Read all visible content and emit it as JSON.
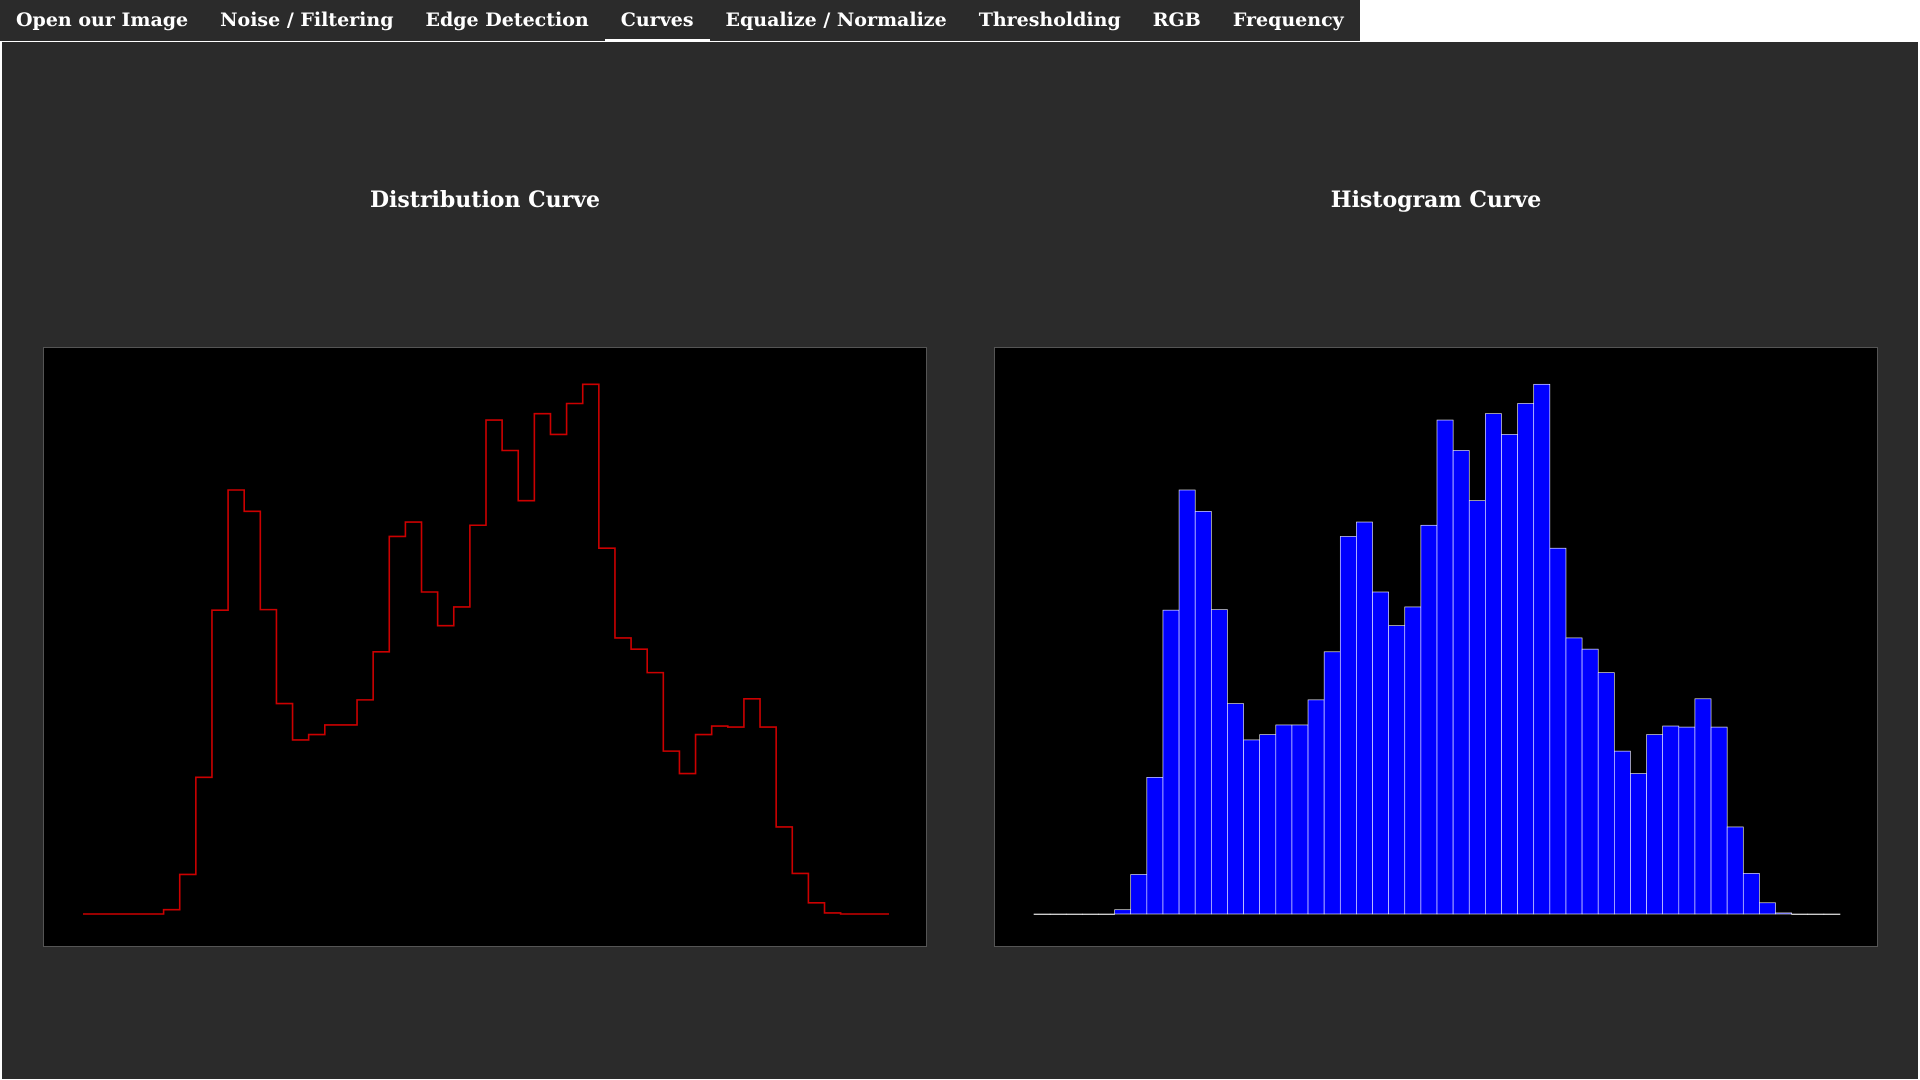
{
  "tabs": [
    {
      "label": "Open our Image",
      "active": false
    },
    {
      "label": "Noise / Filtering",
      "active": false
    },
    {
      "label": "Edge Detection",
      "active": false
    },
    {
      "label": "Curves",
      "active": true
    },
    {
      "label": "Equalize / Normalize",
      "active": false
    },
    {
      "label": "Thresholding",
      "active": false
    },
    {
      "label": "RGB",
      "active": false
    },
    {
      "label": "Frequency",
      "active": false
    }
  ],
  "colors": {
    "background": "#2b2b2b",
    "plot_background": "#000000",
    "distribution_line": "#cc0000",
    "histogram_fill": "#0000ff",
    "histogram_edge": "#ffffff"
  },
  "chart_data": [
    {
      "type": "line",
      "title": "Distribution Curve",
      "step": true,
      "bins": 50,
      "values": [
        0.0,
        0.0,
        0.0,
        0.0,
        0.0,
        0.8,
        7.4,
        25.6,
        56.9,
        79.4,
        75.4,
        57.0,
        39.4,
        32.6,
        33.6,
        35.4,
        35.4,
        40.1,
        49.1,
        70.7,
        73.4,
        60.3,
        54.0,
        57.5,
        72.8,
        92.5,
        86.8,
        77.4,
        93.7,
        89.8,
        95.6,
        99.2,
        68.5,
        51.7,
        49.6,
        45.2,
        30.5,
        26.3,
        33.6,
        35.2,
        35.0,
        40.3,
        35.0,
        16.3,
        7.6,
        2.1,
        0.2,
        0.0,
        0.0,
        0.0
      ],
      "ylim": [
        0,
        100
      ],
      "grid": false
    },
    {
      "type": "bar",
      "title": "Histogram Curve",
      "bins": 50,
      "values": [
        0.0,
        0.0,
        0.0,
        0.0,
        0.0,
        0.8,
        7.4,
        25.6,
        56.9,
        79.4,
        75.4,
        57.0,
        39.4,
        32.6,
        33.6,
        35.4,
        35.4,
        40.1,
        49.1,
        70.7,
        73.4,
        60.3,
        54.0,
        57.5,
        72.8,
        92.5,
        86.8,
        77.4,
        93.7,
        89.8,
        95.6,
        99.2,
        68.5,
        51.7,
        49.6,
        45.2,
        30.5,
        26.3,
        33.6,
        35.2,
        35.0,
        40.3,
        35.0,
        16.3,
        7.6,
        2.1,
        0.2,
        0.0,
        0.0,
        0.0
      ],
      "ylim": [
        0,
        100
      ],
      "grid": false
    }
  ]
}
